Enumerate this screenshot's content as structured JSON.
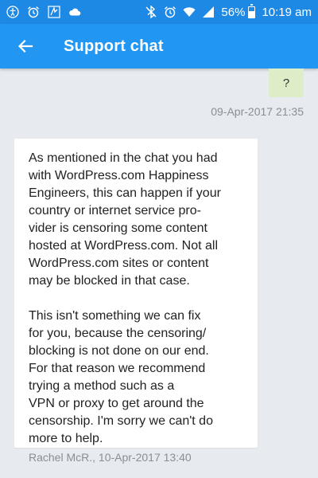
{
  "status_bar": {
    "battery_percent": "56%",
    "battery_level": 0.56,
    "time": "10:19 am",
    "left_icons": [
      "accessibility-icon",
      "alarm-icon",
      "app-notification-icon",
      "cloud-icon"
    ],
    "right_icons": [
      "bluetooth-icon",
      "alarm-icon",
      "wifi-icon",
      "signal-icon",
      "battery-icon"
    ]
  },
  "app_bar": {
    "title": "Support chat",
    "back_icon": "arrow-left-icon",
    "color": "#2196f3"
  },
  "chat": {
    "outgoing": {
      "text": "?",
      "timestamp": "09-Apr-2017 21:35",
      "color": "#dcedc8"
    },
    "incoming": {
      "paragraph1_lines": [
        "As mentioned in the chat you had",
        "with WordPress.com Happiness",
        "Engineers, this can happen if your",
        "country or internet service pro-",
        "vider is censoring some content",
        "hosted at WordPress.com. Not all",
        "WordPress.com sites or content",
        "may be blocked in that case."
      ],
      "paragraph2_lines": [
        "This isn't something we can fix",
        "for you, because the censoring/",
        "blocking is not done on our end.",
        "For that reason we recommend",
        "trying a method such as a",
        "VPN or proxy to get around the",
        "censorship. I'm sorry we can't do",
        "more to help."
      ],
      "meta": "Rachel McR., 10-Apr-2017 13:40"
    }
  }
}
